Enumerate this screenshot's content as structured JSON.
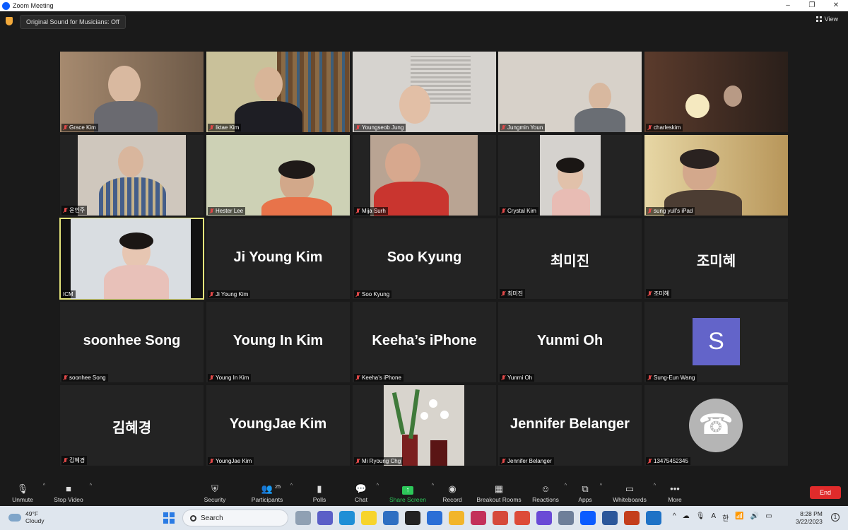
{
  "window": {
    "title": "Zoom Meeting"
  },
  "topbar": {
    "sound_label": "Original Sound for Musicians: Off",
    "view_label": "View"
  },
  "tiles": [
    {
      "label": "Grace Kim",
      "big": ""
    },
    {
      "label": "Iktae Kim",
      "big": ""
    },
    {
      "label": "Youngseob Jung",
      "big": ""
    },
    {
      "label": "Jungmin Youn",
      "big": ""
    },
    {
      "label": "charleskim",
      "big": ""
    },
    {
      "label": "윤인주",
      "big": ""
    },
    {
      "label": "Hester Lee",
      "big": ""
    },
    {
      "label": "Mija Surh",
      "big": ""
    },
    {
      "label": "Crystal Kim",
      "big": ""
    },
    {
      "label": "sung yull's iPad",
      "big": ""
    },
    {
      "label": "ICM",
      "big": ""
    },
    {
      "label": "Ji Young Kim",
      "big": "Ji Young Kim"
    },
    {
      "label": "Soo Kyung",
      "big": "Soo Kyung"
    },
    {
      "label": "최미진",
      "big": "최미진"
    },
    {
      "label": "조미혜",
      "big": "조미혜"
    },
    {
      "label": "soonhee Song",
      "big": "soonhee Song"
    },
    {
      "label": "Young In Kim",
      "big": "Young In Kim"
    },
    {
      "label": "Keeha’s iPhone",
      "big": "Keeha’s iPhone"
    },
    {
      "label": "Yunmi Oh",
      "big": "Yunmi Oh"
    },
    {
      "label": "Sung-Eun Wang",
      "big": ""
    },
    {
      "label": "김혜경",
      "big": "김혜경"
    },
    {
      "label": "YoungJae Kim",
      "big": "YoungJae Kim"
    },
    {
      "label": "Mi Ryoung Chg",
      "big": ""
    },
    {
      "label": "Jennifer Belanger",
      "big": "Jennifer Belanger"
    },
    {
      "label": "13475452345",
      "big": ""
    }
  ],
  "avatar_s": "S",
  "toolbar": {
    "unmute": "Unmute",
    "stop_video": "Stop Video",
    "security": "Security",
    "participants": "Participants",
    "participants_count": "25",
    "polls": "Polls",
    "chat": "Chat",
    "share_screen": "Share Screen",
    "record": "Record",
    "breakout_rooms": "Breakout Rooms",
    "reactions": "Reactions",
    "apps": "Apps",
    "whiteboards": "Whiteboards",
    "more": "More",
    "end": "End"
  },
  "taskbar": {
    "temp": "49°F",
    "weather": "Cloudy",
    "search": "Search",
    "tray_chevron": "^",
    "input_lang": "A",
    "ime": "한",
    "time": "8:28 PM",
    "date": "3/22/2023",
    "notif_count": "1"
  },
  "colors": {
    "share_green": "#2dc85a",
    "end_red": "#e02b2b",
    "avatar_purple": "#6364c9",
    "active_speaker": "#e4e47a"
  }
}
